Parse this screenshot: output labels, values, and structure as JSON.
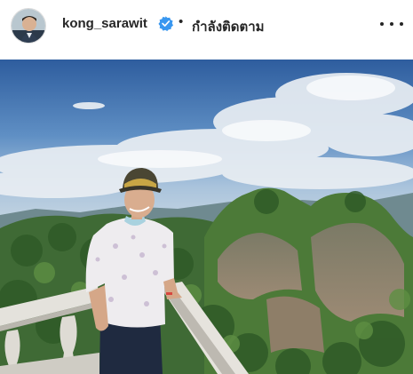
{
  "post": {
    "username": "kong_sarawit",
    "separator": "•",
    "follow_status": "กำลังติดตาม",
    "verified_icon": "verified-badge-icon",
    "more_icon": "more-options-icon"
  },
  "colors": {
    "verified_blue": "#3897f0",
    "text": "#262626"
  }
}
